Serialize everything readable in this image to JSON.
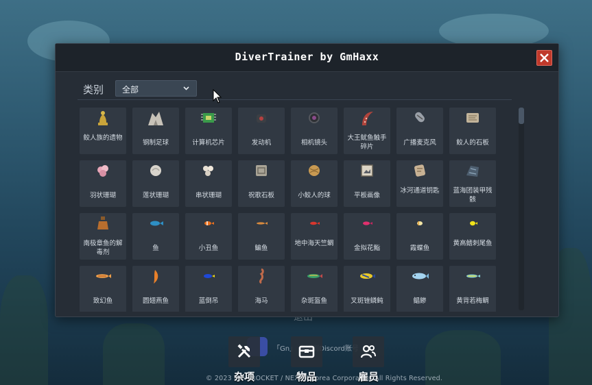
{
  "dialog": {
    "title": "DiverTrainer by GmHaxx",
    "filter_label": "类别",
    "filter_value": "全部"
  },
  "items": [
    {
      "label": "鲛人族的遗物",
      "icon": "statue-icon"
    },
    {
      "label": "钢制足球",
      "icon": "rock-pile-icon"
    },
    {
      "label": "计算机芯片",
      "icon": "chip-icon"
    },
    {
      "label": "发动机",
      "icon": "engine-icon"
    },
    {
      "label": "相机镜头",
      "icon": "lens-icon"
    },
    {
      "label": "大王鱿鱼触手碎片",
      "icon": "tentacle-icon"
    },
    {
      "label": "广播麦克风",
      "icon": "microphone-icon"
    },
    {
      "label": "鲛人的石板",
      "icon": "stone-tablet-icon"
    },
    {
      "label": "羽状珊瑚",
      "icon": "coral-pink-icon"
    },
    {
      "label": "莲状珊瑚",
      "icon": "coral-white-icon"
    },
    {
      "label": "串状珊瑚",
      "icon": "coral-cluster-icon"
    },
    {
      "label": "祝歌石板",
      "icon": "carved-tablet-icon"
    },
    {
      "label": "小鲛人的球",
      "icon": "ball-icon"
    },
    {
      "label": "平板画像",
      "icon": "picture-icon"
    },
    {
      "label": "冰河通道钥匙",
      "icon": "key-stone-icon"
    },
    {
      "label": "蓝海团装甲残骸",
      "icon": "armor-wreck-icon"
    },
    {
      "label": "南极章鱼的解毒剂",
      "icon": "potion-icon"
    },
    {
      "label": "鱼",
      "icon": "fish-blue-icon"
    },
    {
      "label": "小丑鱼",
      "icon": "clownfish-icon"
    },
    {
      "label": "鳊鱼",
      "icon": "bream-icon"
    },
    {
      "label": "地中海天竺鲷",
      "icon": "cardinalfish-icon"
    },
    {
      "label": "金拟花鮨",
      "icon": "anthias-icon"
    },
    {
      "label": "霞蝶鱼",
      "icon": "butterflyfish-icon"
    },
    {
      "label": "黄高鳍刺尾鱼",
      "icon": "tang-yellow-icon"
    },
    {
      "label": "致幻鱼",
      "icon": "fish-orange-icon"
    },
    {
      "label": "圆翅燕鱼",
      "icon": "batfish-icon"
    },
    {
      "label": "蓝倒吊",
      "icon": "blue-tang-icon"
    },
    {
      "label": "海马",
      "icon": "seahorse-icon"
    },
    {
      "label": "杂斑盔鱼",
      "icon": "wrasse-icon"
    },
    {
      "label": "叉斑锉鳞鲀",
      "icon": "triggerfish-icon"
    },
    {
      "label": "鲳鲹",
      "icon": "pompano-icon"
    },
    {
      "label": "黄背若梅鲷",
      "icon": "snapper-icon"
    }
  ],
  "background": {
    "partial_text": "退出",
    "discord_text": "「Gn」 连接到Discord账号",
    "copyright": "© 2023 MINTROCKET / NEXON Korea Corporation All Rights Reserved."
  },
  "bottom_nav": [
    {
      "label": "杂项",
      "icon": "tools-icon"
    },
    {
      "label": "物品",
      "icon": "chest-icon"
    },
    {
      "label": "雇员",
      "icon": "staff-icon"
    }
  ],
  "colors": {
    "dialog_bg": "#262d36",
    "tile_bg": "#313943",
    "close_red": "#c0392b",
    "select_bg": "#3a4653"
  }
}
